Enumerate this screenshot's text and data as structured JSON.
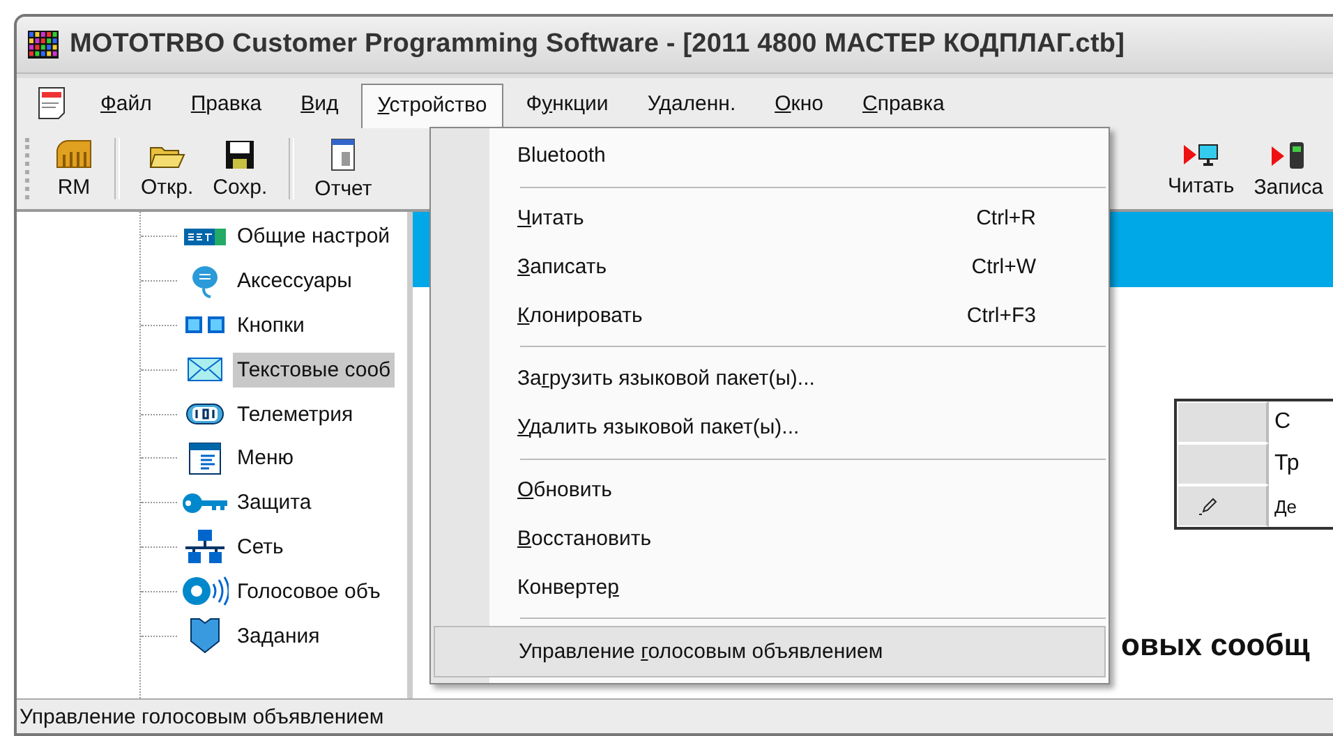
{
  "window": {
    "title": "MOTOTRBO Customer Programming Software - [2011 4800 МАСТЕР КОДПЛАГ.ctb]"
  },
  "menu_bar": [
    {
      "label": {
        "key": "Ф",
        "after": "айл"
      },
      "selected": false
    },
    {
      "label": {
        "key": "П",
        "after": "равка"
      },
      "selected": false
    },
    {
      "label": {
        "key": "В",
        "after": "ид"
      },
      "selected": false
    },
    {
      "label": {
        "key": "У",
        "after": "стройство"
      },
      "selected": true
    },
    {
      "label": {
        "before": "Ф",
        "key": "у",
        "after": "нкции"
      },
      "selected": false
    },
    {
      "label": {
        "before": "У",
        "key": "д",
        "after": "аленн."
      },
      "selected": false
    },
    {
      "label": {
        "key": "О",
        "after": "кно"
      },
      "selected": false
    },
    {
      "label": {
        "key": "С",
        "after": "правка"
      },
      "selected": false
    }
  ],
  "toolbar": {
    "left": [
      {
        "kind": "rm",
        "label": "RM"
      },
      {
        "kind": "sep"
      },
      {
        "kind": "open",
        "label": "Откр."
      },
      {
        "kind": "save",
        "label": "Сохр."
      },
      {
        "kind": "sep"
      },
      {
        "kind": "report",
        "label": "Отчет"
      }
    ],
    "right": [
      {
        "kind": "read",
        "label": "Читать"
      },
      {
        "kind": "write",
        "label": "Записа"
      }
    ]
  },
  "tree": [
    {
      "kind": "set",
      "label": "Общие настрой",
      "selected": false
    },
    {
      "kind": "accessory",
      "label": "Аксессуары",
      "selected": false
    },
    {
      "kind": "buttons",
      "label": "Кнопки",
      "selected": false
    },
    {
      "kind": "mail",
      "label": "Текстовые сооб",
      "selected": true
    },
    {
      "kind": "telemetry",
      "label": "Телеметрия",
      "selected": false
    },
    {
      "kind": "menu",
      "label": "Меню",
      "selected": false
    },
    {
      "kind": "key",
      "label": "Защита",
      "selected": false
    },
    {
      "kind": "network",
      "label": "Сеть",
      "selected": false
    },
    {
      "kind": "speaker",
      "label": "Голосовое объ",
      "selected": false
    },
    {
      "kind": "job",
      "label": "Задания",
      "selected": false
    }
  ],
  "dropdown": [
    {
      "kind": "item",
      "label": {
        "before": "Bluetooth"
      },
      "selected": false
    },
    {
      "kind": "sep"
    },
    {
      "kind": "item",
      "label": {
        "key": "Ч",
        "after": "итать"
      },
      "shortcut": "Ctrl+R",
      "selected": false
    },
    {
      "kind": "item",
      "label": {
        "key": "З",
        "after": "аписать"
      },
      "shortcut": "Ctrl+W",
      "selected": false
    },
    {
      "kind": "item",
      "label": {
        "key": "К",
        "after": "лонировать"
      },
      "shortcut": "Ctrl+F3",
      "selected": false
    },
    {
      "kind": "sep"
    },
    {
      "kind": "item",
      "label": {
        "before": "За",
        "key": "г",
        "after": "рузить языковой пакет(ы)..."
      },
      "selected": false
    },
    {
      "kind": "item",
      "label": {
        "key": "У",
        "after": "далить языковой пакет(ы)..."
      },
      "selected": false
    },
    {
      "kind": "sep"
    },
    {
      "kind": "item",
      "label": {
        "key": "О",
        "after": "бновить"
      },
      "selected": false
    },
    {
      "kind": "item",
      "label": {
        "key": "В",
        "after": "осстановить"
      },
      "selected": false
    },
    {
      "kind": "item",
      "label": {
        "before": "Конверте",
        "key": "р"
      },
      "selected": false
    },
    {
      "kind": "sep"
    },
    {
      "kind": "item",
      "label": {
        "before": "Управление ",
        "key": "г",
        "after": "олосовым объявлением"
      },
      "selected": true
    }
  ],
  "content": {
    "table": {
      "header": [
        "С"
      ],
      "rows": [
        {
          "cell": "Тр",
          "editing": false
        },
        {
          "cell": "Де",
          "editing": true
        }
      ]
    },
    "heading": "овых сообщ"
  },
  "status_bar": "Управление голосовым объявлением"
}
